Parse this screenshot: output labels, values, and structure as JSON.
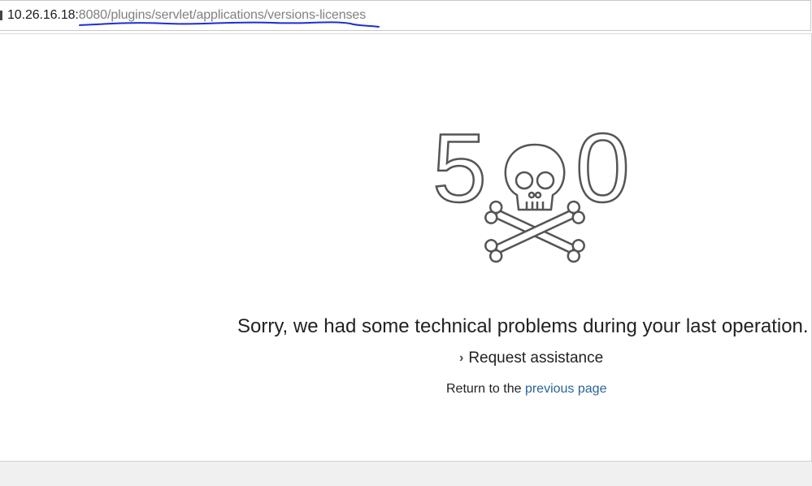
{
  "address_bar": {
    "host": "10.26.16.18:",
    "path": "8080/plugins/servlet/applications/versions-licenses"
  },
  "error": {
    "code_left": "5",
    "code_right": "0",
    "graphic": "skull-crossbones-icon",
    "message": "Sorry, we had some technical problems during your last operation.",
    "assist_label": "Request assistance",
    "return_prefix": "Return to the ",
    "return_link": "previous page"
  },
  "colors": {
    "link": "#2a6496",
    "annotation": "#1a2fd6",
    "graphic_stroke": "#555555"
  }
}
